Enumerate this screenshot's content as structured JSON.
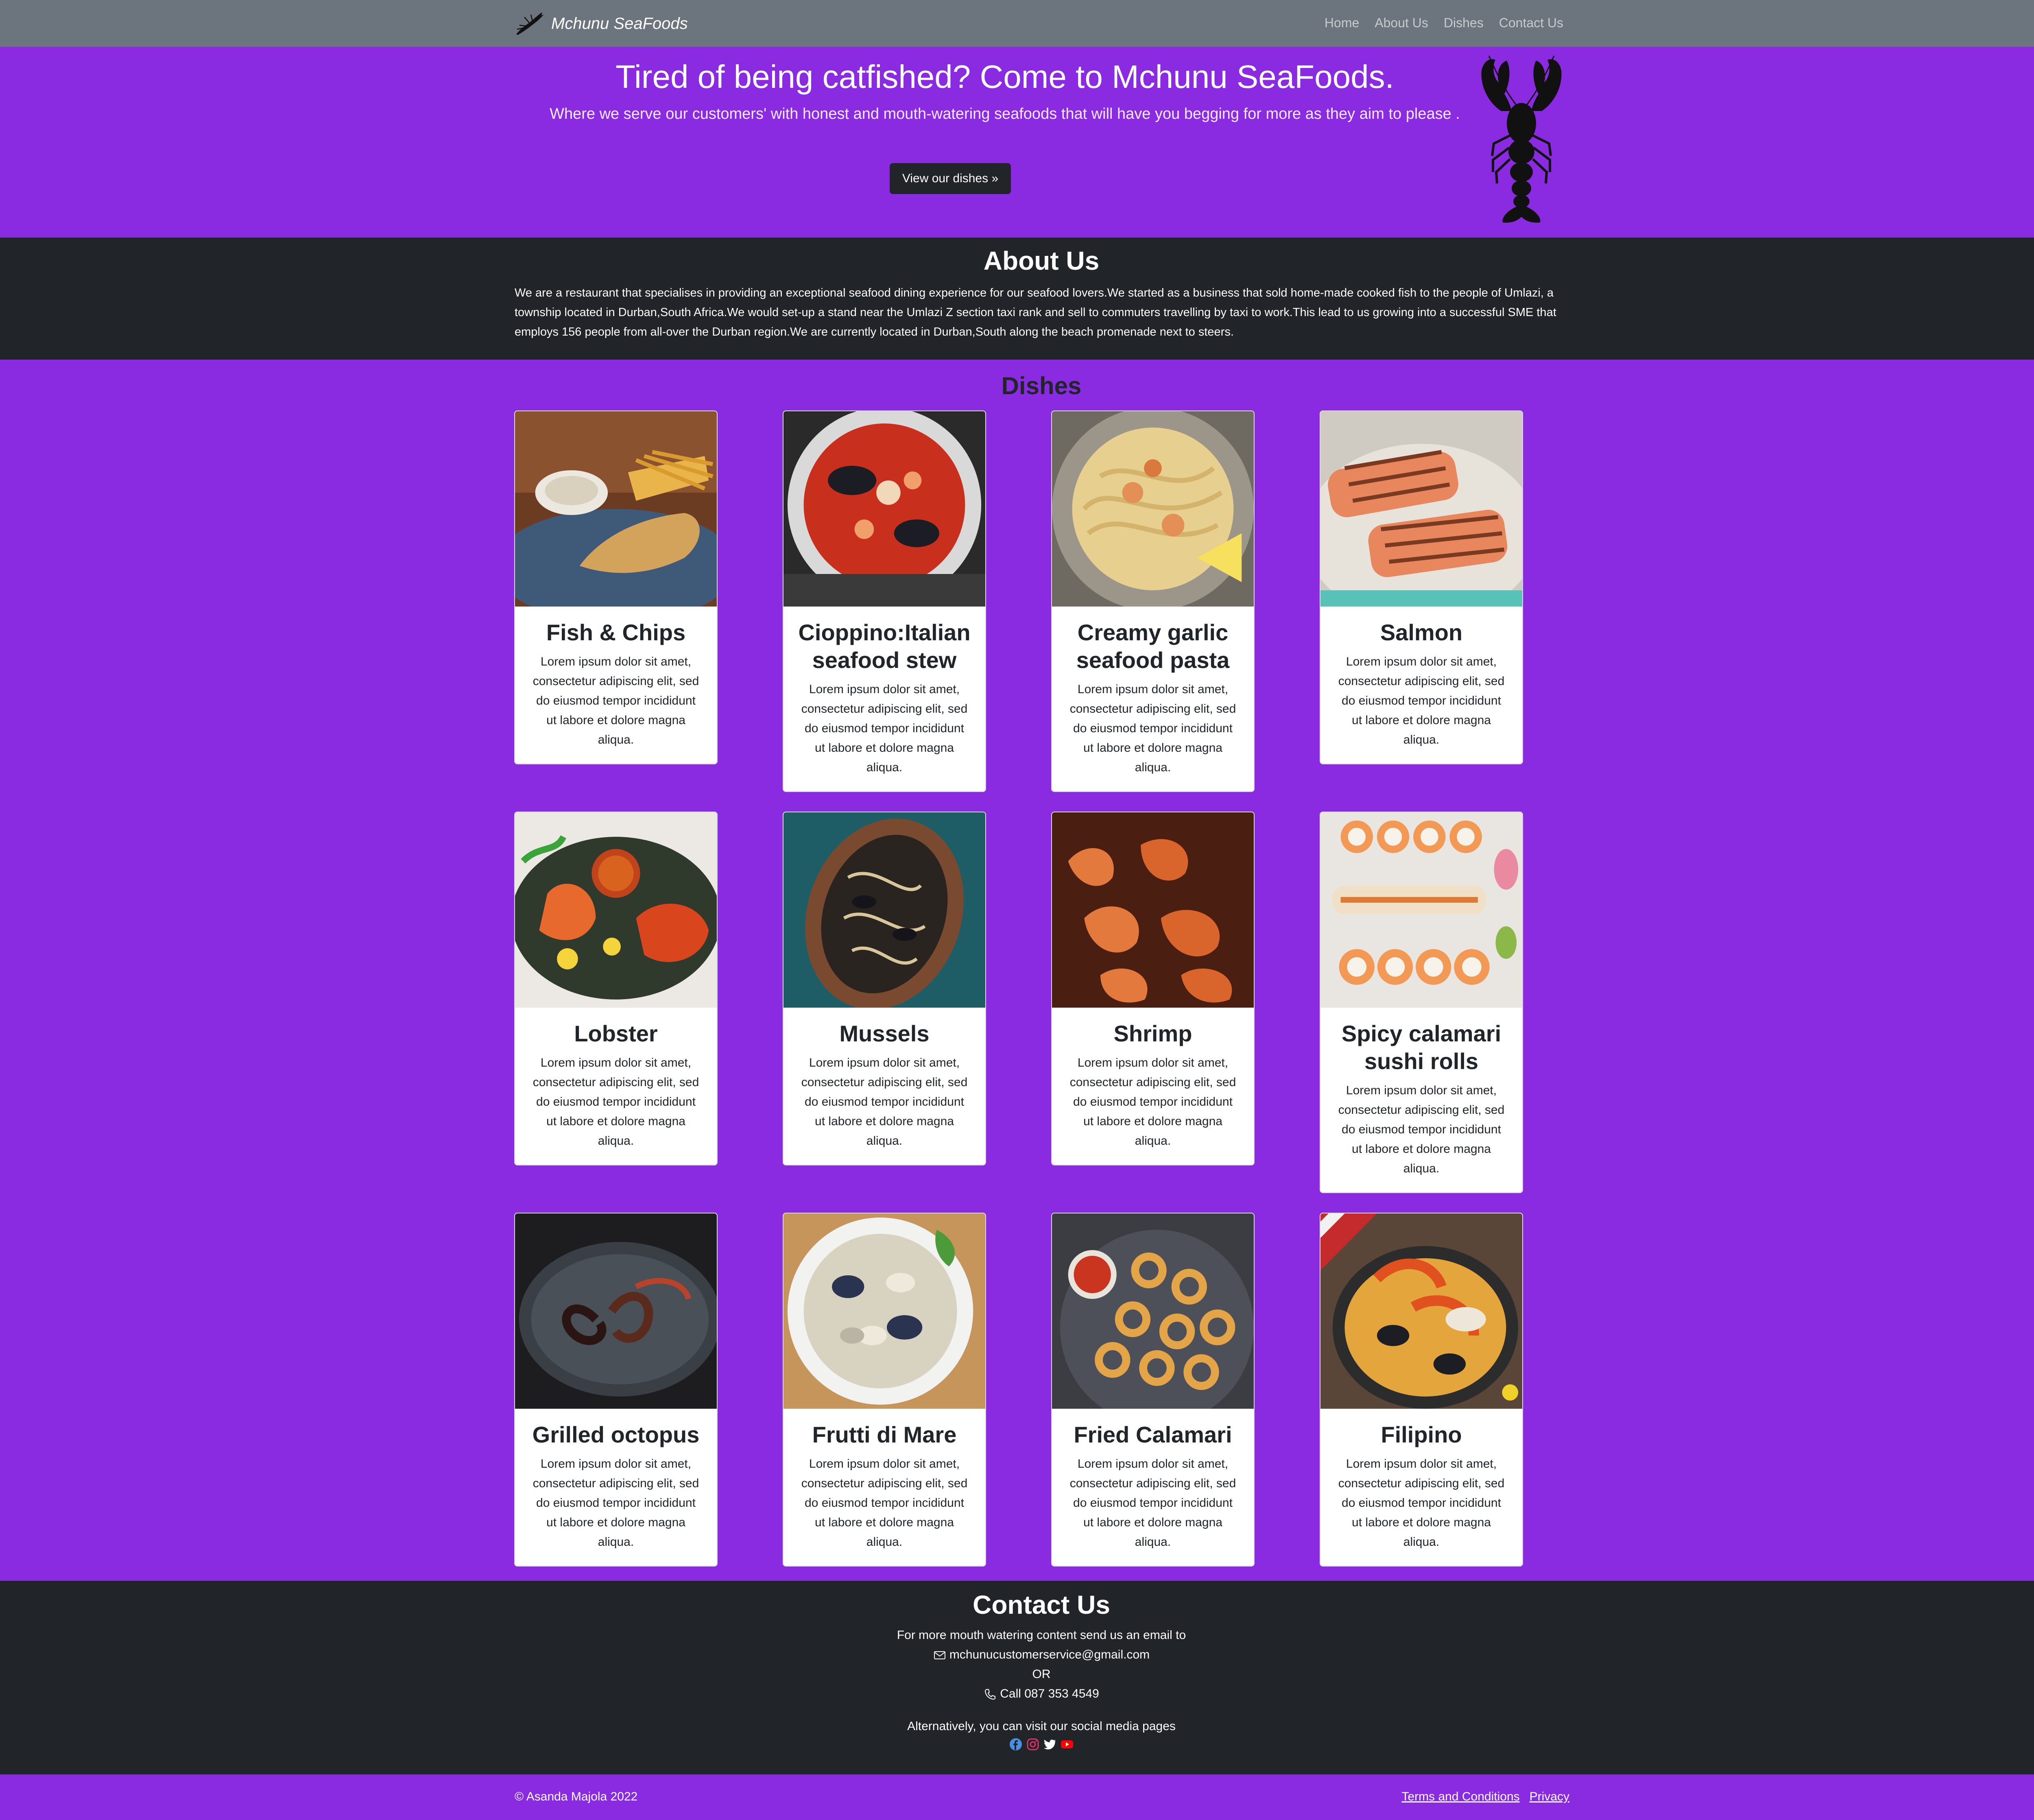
{
  "navbar": {
    "brand": "Mchunu SeaFoods",
    "links": [
      "Home",
      "About Us",
      "Dishes",
      "Contact Us"
    ]
  },
  "hero": {
    "title": "Tired of being catfished? Come to Mchunu SeaFoods.",
    "subtitle": "Where we serve our customers' with honest and mouth-watering seafoods that will have you begging for more as they aim to please .",
    "button": "View our dishes »"
  },
  "about": {
    "title": "About Us",
    "text": "We are a restaurant that specialises in providing an exceptional seafood dining experience for our seafood lovers.We started as a business that sold home-made cooked fish to the people of Umlazi, a township located in Durban,South Africa.We would set-up a stand near the Umlazi Z section taxi rank and sell to commuters travelling by taxi to work.This lead to us growing into a successful SME that employs 156 people from all-over the Durban region.We are currently located in Durban,South along the beach promenade next to steers."
  },
  "dishes": {
    "title": "Dishes",
    "items": [
      {
        "title": "Fish & Chips",
        "text": "Lorem ipsum dolor sit amet, consectetur adipiscing elit, sed do eiusmod tempor incididunt ut labore et dolore magna aliqua."
      },
      {
        "title": "Cioppino:Italian seafood stew",
        "text": "Lorem ipsum dolor sit amet, consectetur adipiscing elit, sed do eiusmod tempor incididunt ut labore et dolore magna aliqua."
      },
      {
        "title": "Creamy garlic seafood pasta",
        "text": "Lorem ipsum dolor sit amet, consectetur adipiscing elit, sed do eiusmod tempor incididunt ut labore et dolore magna aliqua."
      },
      {
        "title": "Salmon",
        "text": "Lorem ipsum dolor sit amet, consectetur adipiscing elit, sed do eiusmod tempor incididunt ut labore et dolore magna aliqua."
      },
      {
        "title": "Lobster",
        "text": "Lorem ipsum dolor sit amet, consectetur adipiscing elit, sed do eiusmod tempor incididunt ut labore et dolore magna aliqua."
      },
      {
        "title": "Mussels",
        "text": "Lorem ipsum dolor sit amet, consectetur adipiscing elit, sed do eiusmod tempor incididunt ut labore et dolore magna aliqua."
      },
      {
        "title": "Shrimp",
        "text": "Lorem ipsum dolor sit amet, consectetur adipiscing elit, sed do eiusmod tempor incididunt ut labore et dolore magna aliqua."
      },
      {
        "title": "Spicy calamari sushi rolls",
        "text": "Lorem ipsum dolor sit amet, consectetur adipiscing elit, sed do eiusmod tempor incididunt ut labore et dolore magna aliqua."
      },
      {
        "title": "Grilled octopus",
        "text": "Lorem ipsum dolor sit amet, consectetur adipiscing elit, sed do eiusmod tempor incididunt ut labore et dolore magna aliqua."
      },
      {
        "title": "Frutti di Mare",
        "text": "Lorem ipsum dolor sit amet, consectetur adipiscing elit, sed do eiusmod tempor incididunt ut labore et dolore magna aliqua."
      },
      {
        "title": "Fried Calamari",
        "text": "Lorem ipsum dolor sit amet, consectetur adipiscing elit, sed do eiusmod tempor incididunt ut labore et dolore magna aliqua."
      },
      {
        "title": "Filipino",
        "text": "Lorem ipsum dolor sit amet, consectetur adipiscing elit, sed do eiusmod tempor incididunt ut labore et dolore magna aliqua."
      }
    ]
  },
  "contact": {
    "title": "Contact Us",
    "intro": "For more mouth watering content send us an email to",
    "email": "mchunucustomerservice@gmail.com",
    "or": "OR",
    "phone": "Call 087 353 4549",
    "social_intro": "Alternatively, you can visit our social media pages",
    "social_icons": [
      "facebook-icon",
      "instagram-icon",
      "twitter-icon",
      "youtube-icon"
    ]
  },
  "footer": {
    "copyright": "© Asanda Majola 2022",
    "links": [
      "Terms and Conditions",
      "Privacy"
    ]
  },
  "colors": {
    "purple": "#8a2be2",
    "dark": "#212529",
    "navbar": "#6c757d"
  }
}
